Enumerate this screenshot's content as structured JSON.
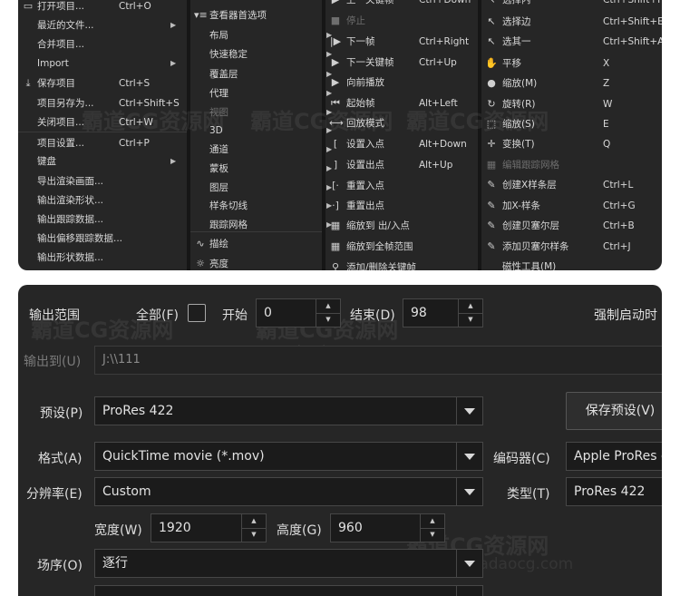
{
  "menu_file": [
    {
      "icon": "folder-open-icon",
      "glyph": "▭",
      "label": "打开项目...",
      "shortcut": "Ctrl+O",
      "arrow": false
    },
    {
      "icon": "",
      "glyph": "",
      "label": "最近的文件...",
      "shortcut": "",
      "arrow": true
    },
    {
      "icon": "",
      "glyph": "",
      "label": "合并项目...",
      "shortcut": "",
      "arrow": false
    },
    {
      "icon": "",
      "glyph": "",
      "label": "Import",
      "shortcut": "",
      "arrow": true
    },
    {
      "icon": "download-icon",
      "glyph": "⤓",
      "label": "保存项目",
      "shortcut": "Ctrl+S",
      "arrow": false
    },
    {
      "icon": "",
      "glyph": "",
      "label": "项目另存为...",
      "shortcut": "Ctrl+Shift+S",
      "arrow": false
    },
    {
      "icon": "",
      "glyph": "",
      "label": "关闭项目...",
      "shortcut": "Ctrl+W",
      "arrow": false
    },
    {
      "icon": "",
      "glyph": "",
      "label": "项目设置...",
      "shortcut": "Ctrl+P",
      "arrow": false
    },
    {
      "icon": "",
      "glyph": "",
      "label": "键盘",
      "shortcut": "",
      "arrow": true
    },
    {
      "icon": "",
      "glyph": "",
      "label": "导出渲染画面...",
      "shortcut": "",
      "arrow": false
    },
    {
      "icon": "",
      "glyph": "",
      "label": "输出渲染形状...",
      "shortcut": "",
      "arrow": false
    },
    {
      "icon": "",
      "glyph": "",
      "label": "输出跟踪数据...",
      "shortcut": "",
      "arrow": false
    },
    {
      "icon": "",
      "glyph": "",
      "label": "输出偏移跟踪数据...",
      "shortcut": "",
      "arrow": false
    },
    {
      "icon": "",
      "glyph": "",
      "label": "输出形状数据...",
      "shortcut": "",
      "arrow": false
    }
  ],
  "menu_view": [
    {
      "icon": "viewer-prefs-icon",
      "glyph": "▾≡",
      "label": "查看器首选项",
      "arrow": false,
      "disabled": false
    },
    {
      "icon": "",
      "glyph": "",
      "label": "布局",
      "arrow": true,
      "disabled": false
    },
    {
      "icon": "",
      "glyph": "",
      "label": "快速稳定",
      "arrow": true,
      "disabled": false
    },
    {
      "icon": "",
      "glyph": "",
      "label": "覆盖层",
      "arrow": true,
      "disabled": false
    },
    {
      "icon": "",
      "glyph": "",
      "label": "代理",
      "arrow": true,
      "disabled": false
    },
    {
      "icon": "",
      "glyph": "",
      "label": "视图",
      "arrow": true,
      "disabled": true
    },
    {
      "icon": "",
      "glyph": "",
      "label": "3D",
      "arrow": true,
      "disabled": false
    },
    {
      "icon": "",
      "glyph": "",
      "label": "通道",
      "arrow": true,
      "disabled": false
    },
    {
      "icon": "",
      "glyph": "",
      "label": "蒙板",
      "arrow": true,
      "disabled": false
    },
    {
      "icon": "",
      "glyph": "",
      "label": "图层",
      "arrow": true,
      "disabled": false
    },
    {
      "icon": "",
      "glyph": "",
      "label": "样条切线",
      "arrow": true,
      "disabled": false
    },
    {
      "icon": "",
      "glyph": "",
      "label": "跟踪网格",
      "arrow": true,
      "disabled": false
    },
    {
      "icon": "stroke-icon",
      "glyph": "∿",
      "label": "描绘",
      "arrow": false,
      "disabled": false
    },
    {
      "icon": "brightness-icon",
      "glyph": "☼",
      "label": "亮度",
      "arrow": false,
      "disabled": false
    }
  ],
  "menu_playback": [
    {
      "icon": "",
      "glyph": "▶",
      "label": "上一关键帧",
      "shortcut": "Ctrl+Down",
      "disabled": false
    },
    {
      "icon": "stop-icon",
      "glyph": "■",
      "label": "停止",
      "shortcut": "",
      "disabled": true
    },
    {
      "icon": "next-frame-icon",
      "glyph": "|▶",
      "label": "下一帧",
      "shortcut": "Ctrl+Right",
      "disabled": false
    },
    {
      "icon": "next-keyframe-icon",
      "glyph": "▶",
      "label": "下一关键帧",
      "shortcut": "Ctrl+Up",
      "disabled": false
    },
    {
      "icon": "play-forward-icon",
      "glyph": "▶",
      "label": "向前播放",
      "shortcut": "",
      "disabled": false
    },
    {
      "icon": "start-frame-icon",
      "glyph": "⏮",
      "label": "起始帧",
      "shortcut": "Alt+Left",
      "disabled": false
    },
    {
      "icon": "loop-mode-icon",
      "glyph": "⟷",
      "label": "回放模式",
      "shortcut": "",
      "disabled": false
    },
    {
      "icon": "set-in-point-icon",
      "glyph": "[",
      "label": "设置入点",
      "shortcut": "Alt+Down",
      "disabled": false
    },
    {
      "icon": "set-out-point-icon",
      "glyph": "]",
      "label": "设置出点",
      "shortcut": "Alt+Up",
      "disabled": false
    },
    {
      "icon": "reset-in-point-icon",
      "glyph": "[·",
      "label": "重置入点",
      "shortcut": "",
      "disabled": false
    },
    {
      "icon": "reset-out-point-icon",
      "glyph": "·]",
      "label": "重置出点",
      "shortcut": "",
      "disabled": false
    },
    {
      "icon": "zoom-in-out-icon",
      "glyph": "▦",
      "label": "缩放到 出/入点",
      "shortcut": "",
      "disabled": false
    },
    {
      "icon": "zoom-full-range-icon",
      "glyph": "▦",
      "label": "缩放到全帧范围",
      "shortcut": "",
      "disabled": false
    },
    {
      "icon": "toggle-keyframe-icon",
      "glyph": "⚲",
      "label": "添加/删除关键帧",
      "shortcut": "",
      "disabled": false
    }
  ],
  "menu_tools": [
    {
      "icon": "select-inside-icon",
      "glyph": "↖",
      "label": "选择内",
      "shortcut": "Ctrl+Shift+I",
      "disabled": false
    },
    {
      "icon": "select-edges-icon",
      "glyph": "↖",
      "label": "选择边",
      "shortcut": "Ctrl+Shift+E",
      "disabled": false
    },
    {
      "icon": "select-all-icon",
      "glyph": "↖",
      "label": "选其一",
      "shortcut": "Ctrl+Shift+A",
      "disabled": false
    },
    {
      "icon": "pan-icon",
      "glyph": "✋",
      "label": "平移",
      "shortcut": "X",
      "disabled": false
    },
    {
      "icon": "zoom-icon",
      "glyph": "●",
      "label": "缩放(M)",
      "shortcut": "Z",
      "disabled": false
    },
    {
      "icon": "rotate-icon",
      "glyph": "↻",
      "label": "旋转(R)",
      "shortcut": "W",
      "disabled": false
    },
    {
      "icon": "scale-icon",
      "glyph": "⬚",
      "label": "缩放(S)",
      "shortcut": "E",
      "disabled": false
    },
    {
      "icon": "transform-icon",
      "glyph": "✛",
      "label": "变换(T)",
      "shortcut": "Q",
      "disabled": false
    },
    {
      "icon": "edit-tracking-grid-icon",
      "glyph": "▦",
      "label": "编辑跟踪网格",
      "shortcut": "",
      "disabled": true
    },
    {
      "icon": "create-x-spline-icon",
      "glyph": "✎",
      "label": "创建X样条层",
      "shortcut": "Ctrl+L",
      "disabled": false
    },
    {
      "icon": "add-x-spline-icon",
      "glyph": "✎",
      "label": "加X-样条",
      "shortcut": "Ctrl+G",
      "disabled": false
    },
    {
      "icon": "create-bezier-icon",
      "glyph": "✎",
      "label": "创建贝塞尔层",
      "shortcut": "Ctrl+B",
      "disabled": false
    },
    {
      "icon": "add-bezier-icon",
      "glyph": "✎",
      "label": "添加贝塞尔样条",
      "shortcut": "Ctrl+J",
      "disabled": false
    },
    {
      "icon": "magnetic-tool-icon",
      "glyph": "",
      "label": "磁性工具(M)",
      "shortcut": "",
      "disabled": false
    }
  ],
  "dialog": {
    "output_range_label": "输出范围",
    "all_label": "全部(F)",
    "all_checked": false,
    "start_label": "开始",
    "start_value": "0",
    "end_label": "结束(D)",
    "end_value": "98",
    "force_start_label": "强制启动时",
    "output_to_label": "输出到(U)",
    "output_to_value": "J:\\\\111",
    "preset_label": "预设(P)",
    "preset_value": "ProRes 422",
    "save_preset_button": "保存预设(V)",
    "format_label": "格式(A)",
    "format_value": "QuickTime movie (*.mov)",
    "encoder_label": "编码器(C)",
    "encoder_value": "Apple ProRes e",
    "resolution_label": "分辨率(E)",
    "resolution_value": "Custom",
    "type_label": "类型(T)",
    "type_value": "ProRes 422",
    "width_label": "宽度(W)",
    "width_value": "1920",
    "height_label": "高度(G)",
    "height_value": "960",
    "field_order_label": "场序(O)",
    "field_order_value": "逐行"
  },
  "watermark": {
    "text": "霸道CG资源网",
    "url": "www.badaocg.com"
  }
}
